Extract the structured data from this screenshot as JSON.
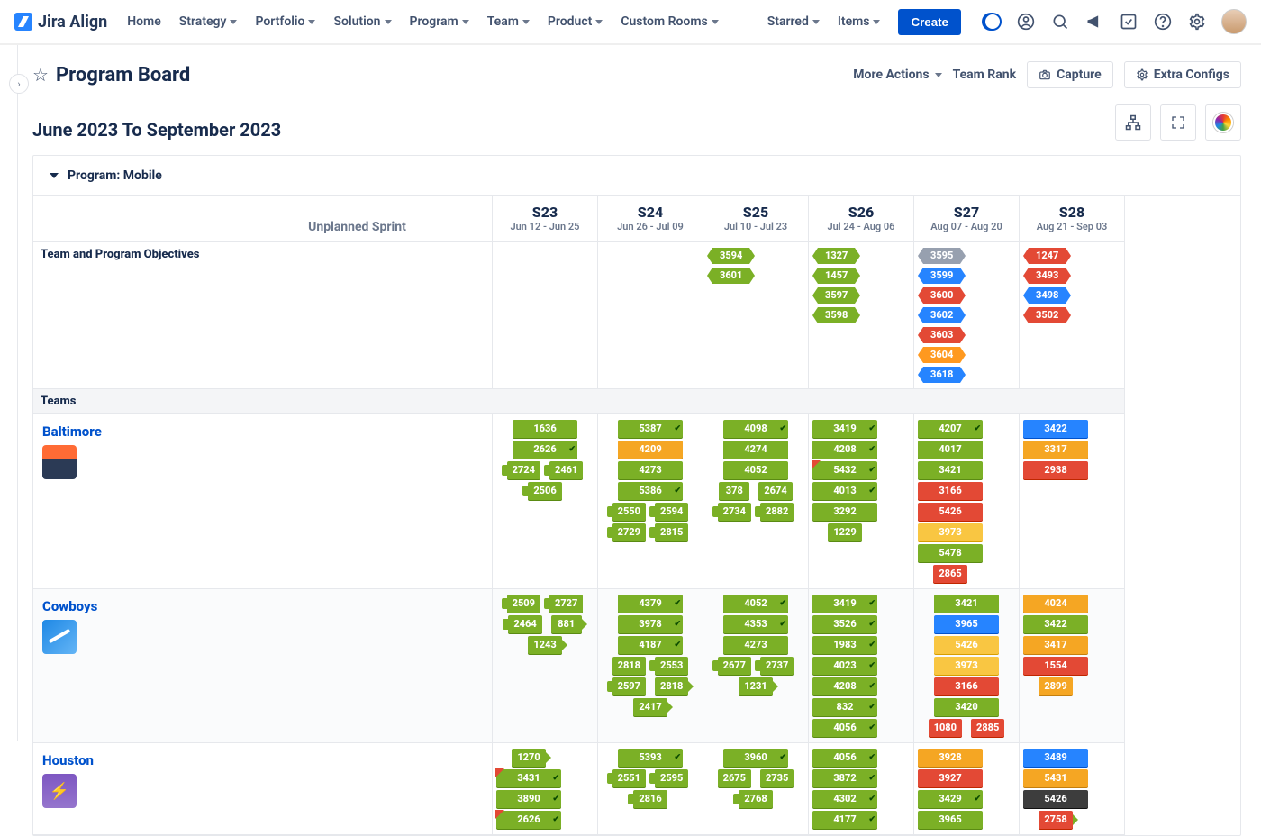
{
  "brand": "Jira Align",
  "nav": [
    "Home",
    "Strategy",
    "Portfolio",
    "Solution",
    "Program",
    "Team",
    "Product",
    "Custom Rooms"
  ],
  "nav_right": [
    "Starred",
    "Items"
  ],
  "create": "Create",
  "page": {
    "title": "Program Board",
    "more": "More Actions",
    "rank": "Team Rank",
    "capture": "Capture",
    "extra": "Extra Configs",
    "range": "June 2023 To September 2023",
    "program_label": "Program: Mobile"
  },
  "columns": [
    {
      "name": "S23",
      "range": "Jun 12 - Jun 25"
    },
    {
      "name": "S24",
      "range": "Jun 26 - Jul 09"
    },
    {
      "name": "S25",
      "range": "Jul 10 - Jul 23"
    },
    {
      "name": "S26",
      "range": "Jul 24 - Aug 06"
    },
    {
      "name": "S27",
      "range": "Aug 07 - Aug 20"
    },
    {
      "name": "S28",
      "range": "Aug 21 - Sep 03"
    }
  ],
  "unplanned_label": "Unplanned Sprint",
  "objectives_label": "Team and Program Objectives",
  "teams_label": "Teams",
  "objectives": {
    "s25": [
      {
        "id": "3594",
        "c": "green"
      },
      {
        "id": "3601",
        "c": "green"
      }
    ],
    "s26": [
      {
        "id": "1327",
        "c": "green"
      },
      {
        "id": "1457",
        "c": "green"
      },
      {
        "id": "3597",
        "c": "green"
      },
      {
        "id": "3598",
        "c": "green"
      }
    ],
    "s27": [
      {
        "id": "3595",
        "c": "grey"
      },
      {
        "id": "3599",
        "c": "blue"
      },
      {
        "id": "3600",
        "c": "red"
      },
      {
        "id": "3602",
        "c": "blue"
      },
      {
        "id": "3603",
        "c": "red"
      },
      {
        "id": "3604",
        "c": "orange"
      },
      {
        "id": "3618",
        "c": "blue"
      }
    ],
    "s28": [
      {
        "id": "1247",
        "c": "red"
      },
      {
        "id": "3493",
        "c": "red"
      },
      {
        "id": "3498",
        "c": "blue"
      },
      {
        "id": "3502",
        "c": "red"
      }
    ]
  },
  "teams": [
    {
      "name": "Baltimore",
      "mark": "mark-balt",
      "cells": {
        "s23": [
          {
            "id": "1636",
            "c": "green",
            "w": "full"
          },
          {
            "id": "2626",
            "c": "green",
            "w": "full",
            "tick": true
          },
          {
            "pair": [
              {
                "id": "2724",
                "c": "green",
                "arrow": "l"
              },
              {
                "id": "2461",
                "c": "green",
                "arrow": "l"
              }
            ]
          },
          {
            "id": "2506",
            "c": "green",
            "w": "small",
            "arrow": "l"
          }
        ],
        "s24": [
          {
            "id": "5387",
            "c": "green",
            "w": "full",
            "tick": true
          },
          {
            "id": "4209",
            "c": "orange",
            "w": "full"
          },
          {
            "id": "4273",
            "c": "green",
            "w": "full"
          },
          {
            "id": "5386",
            "c": "green",
            "w": "full",
            "tick": true
          },
          {
            "pair": [
              {
                "id": "2550",
                "c": "green",
                "arrow": "l"
              },
              {
                "id": "2594",
                "c": "green",
                "arrow": "l"
              }
            ]
          },
          {
            "pair": [
              {
                "id": "2729",
                "c": "green",
                "arrow": "l"
              },
              {
                "id": "2815",
                "c": "green",
                "arrow": "l"
              }
            ]
          }
        ],
        "s25": [
          {
            "id": "4098",
            "c": "green",
            "w": "full",
            "tick": true
          },
          {
            "id": "4274",
            "c": "green",
            "w": "full"
          },
          {
            "id": "4052",
            "c": "green",
            "w": "full"
          },
          {
            "pair": [
              {
                "id": "378",
                "c": "green"
              },
              {
                "id": "2674",
                "c": "green"
              }
            ]
          },
          {
            "pair": [
              {
                "id": "2734",
                "c": "green",
                "arrow": "l"
              },
              {
                "id": "2882",
                "c": "green",
                "arrow": "l"
              }
            ]
          }
        ],
        "s26": [
          {
            "id": "3419",
            "c": "green",
            "w": "full",
            "tick": true
          },
          {
            "id": "4208",
            "c": "green",
            "w": "full",
            "tick": true
          },
          {
            "id": "5432",
            "c": "green",
            "w": "full",
            "tick": true,
            "flag": true
          },
          {
            "id": "4013",
            "c": "green",
            "w": "full",
            "tick": true
          },
          {
            "id": "3292",
            "c": "green",
            "w": "full"
          },
          {
            "id": "1229",
            "c": "green",
            "w": "small"
          }
        ],
        "s27": [
          {
            "id": "4207",
            "c": "green",
            "w": "full",
            "tick": true
          },
          {
            "id": "4017",
            "c": "green",
            "w": "full"
          },
          {
            "id": "3421",
            "c": "green",
            "w": "full"
          },
          {
            "id": "3166",
            "c": "red",
            "w": "full"
          },
          {
            "id": "5426",
            "c": "red",
            "w": "full"
          },
          {
            "id": "3973",
            "c": "yellow",
            "w": "full"
          },
          {
            "id": "5478",
            "c": "green",
            "w": "full"
          },
          {
            "id": "2865",
            "c": "red",
            "w": "small"
          }
        ],
        "s28": [
          {
            "id": "3422",
            "c": "blue",
            "w": "full"
          },
          {
            "id": "3317",
            "c": "orange",
            "w": "full"
          },
          {
            "id": "2938",
            "c": "red",
            "w": "full"
          }
        ]
      }
    },
    {
      "name": "Cowboys",
      "mark": "mark-cow",
      "alt": true,
      "cells": {
        "s23": [
          {
            "pair": [
              {
                "id": "2509",
                "c": "green",
                "arrow": "l"
              },
              {
                "id": "2727",
                "c": "green",
                "arrow": "l"
              }
            ]
          },
          {
            "pair": [
              {
                "id": "2464",
                "c": "green",
                "arrow": "l"
              },
              {
                "id": "881",
                "c": "green",
                "arrow": "r"
              }
            ]
          },
          {
            "id": "1243",
            "c": "green",
            "w": "small",
            "arrow": "r"
          }
        ],
        "s24": [
          {
            "id": "4379",
            "c": "green",
            "w": "full",
            "tick": true
          },
          {
            "id": "3978",
            "c": "green",
            "w": "full",
            "tick": true
          },
          {
            "id": "4187",
            "c": "green",
            "w": "full",
            "tick": true
          },
          {
            "pair": [
              {
                "id": "2818",
                "c": "green"
              },
              {
                "id": "2553",
                "c": "green",
                "arrow": "l"
              }
            ]
          },
          {
            "pair": [
              {
                "id": "2597",
                "c": "green",
                "arrow": "l"
              },
              {
                "id": "2818",
                "c": "green",
                "arrow": "r"
              }
            ]
          },
          {
            "id": "2417",
            "c": "green",
            "w": "small",
            "arrow": "r"
          }
        ],
        "s25": [
          {
            "id": "4052",
            "c": "green",
            "w": "full",
            "tick": true
          },
          {
            "id": "4353",
            "c": "green",
            "w": "full",
            "tick": true
          },
          {
            "id": "4273",
            "c": "green",
            "w": "full"
          },
          {
            "pair": [
              {
                "id": "2677",
                "c": "green",
                "arrow": "l"
              },
              {
                "id": "2737",
                "c": "green",
                "arrow": "l"
              }
            ]
          },
          {
            "id": "1231",
            "c": "green",
            "w": "small",
            "arrow": "r"
          }
        ],
        "s26": [
          {
            "id": "3419",
            "c": "green",
            "w": "full",
            "tick": true
          },
          {
            "id": "3526",
            "c": "green",
            "w": "full",
            "tick": true
          },
          {
            "id": "1983",
            "c": "green",
            "w": "full",
            "tick": true
          },
          {
            "id": "4023",
            "c": "green",
            "w": "full",
            "tick": true
          },
          {
            "id": "4208",
            "c": "green",
            "w": "full",
            "tick": true
          },
          {
            "id": "832",
            "c": "green",
            "w": "full",
            "tick": true
          },
          {
            "id": "4056",
            "c": "green",
            "w": "full",
            "tick": true
          }
        ],
        "s27": [
          {
            "id": "3421",
            "c": "green",
            "w": "full"
          },
          {
            "id": "3965",
            "c": "blue",
            "w": "full"
          },
          {
            "id": "5426",
            "c": "yellow",
            "w": "full"
          },
          {
            "id": "3973",
            "c": "yellow",
            "w": "full"
          },
          {
            "id": "3166",
            "c": "red",
            "w": "full"
          },
          {
            "id": "3420",
            "c": "green",
            "w": "full"
          },
          {
            "pair": [
              {
                "id": "1080",
                "c": "red"
              },
              {
                "id": "2885",
                "c": "red"
              }
            ]
          }
        ],
        "s28": [
          {
            "id": "4024",
            "c": "orange",
            "w": "full"
          },
          {
            "id": "3422",
            "c": "green",
            "w": "full"
          },
          {
            "id": "3417",
            "c": "orange",
            "w": "full"
          },
          {
            "id": "1554",
            "c": "red",
            "w": "full"
          },
          {
            "id": "2899",
            "c": "orange",
            "w": "small"
          }
        ]
      }
    },
    {
      "name": "Houston",
      "mark": "mark-hou",
      "cells": {
        "s23": [
          {
            "id": "1270",
            "c": "green",
            "w": "small",
            "arrow": "r"
          },
          {
            "id": "3431",
            "c": "green",
            "w": "full",
            "tick": true,
            "flag": true
          },
          {
            "id": "3890",
            "c": "green",
            "w": "full",
            "tick": true
          },
          {
            "id": "2626",
            "c": "green",
            "w": "full",
            "tick": true,
            "flag": true
          }
        ],
        "s24": [
          {
            "id": "5393",
            "c": "green",
            "w": "full",
            "tick": true
          },
          {
            "pair": [
              {
                "id": "2551",
                "c": "green",
                "arrow": "l"
              },
              {
                "id": "2595",
                "c": "green",
                "arrow": "l"
              }
            ]
          },
          {
            "id": "2816",
            "c": "green",
            "w": "small",
            "arrow": "l"
          }
        ],
        "s25": [
          {
            "id": "3960",
            "c": "green",
            "w": "full",
            "tick": true
          },
          {
            "pair": [
              {
                "id": "2675",
                "c": "green"
              },
              {
                "id": "2735",
                "c": "green"
              }
            ]
          },
          {
            "id": "2768",
            "c": "green",
            "w": "small",
            "arrow": "l"
          }
        ],
        "s26": [
          {
            "id": "4056",
            "c": "green",
            "w": "full",
            "tick": true
          },
          {
            "id": "3872",
            "c": "green",
            "w": "full",
            "tick": true
          },
          {
            "id": "4302",
            "c": "green",
            "w": "full",
            "tick": true
          },
          {
            "id": "4177",
            "c": "green",
            "w": "full",
            "tick": true
          }
        ],
        "s27": [
          {
            "id": "3928",
            "c": "orange",
            "w": "full"
          },
          {
            "id": "3927",
            "c": "red",
            "w": "full"
          },
          {
            "id": "3429",
            "c": "green",
            "w": "full",
            "tick": true
          },
          {
            "id": "3965",
            "c": "green",
            "w": "full"
          }
        ],
        "s28": [
          {
            "id": "3489",
            "c": "blue",
            "w": "full"
          },
          {
            "id": "5431",
            "c": "orange",
            "w": "full"
          },
          {
            "id": "5426",
            "c": "dark",
            "w": "full"
          },
          {
            "id": "2758",
            "c": "red",
            "w": "small",
            "arrow": "r"
          }
        ]
      }
    }
  ]
}
